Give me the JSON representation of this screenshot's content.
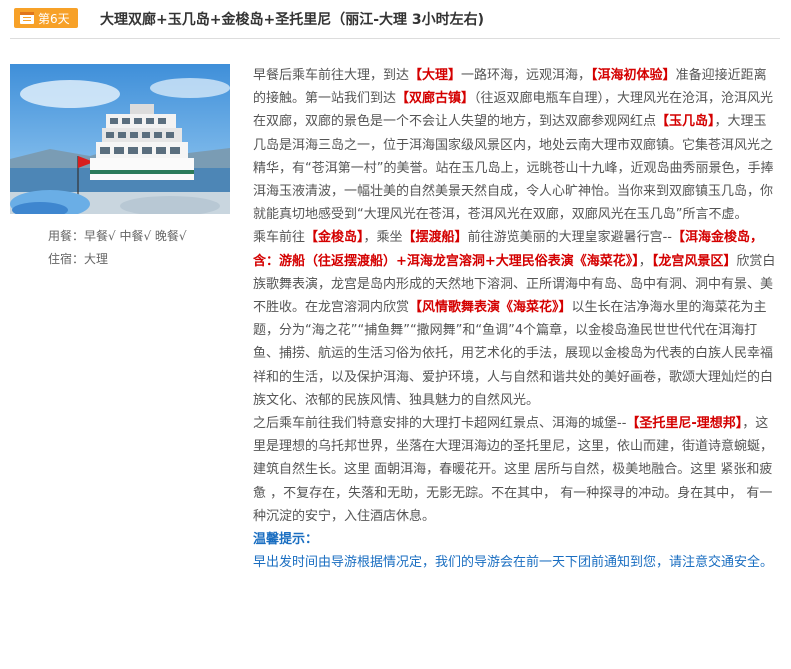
{
  "header": {
    "day_label": "第6天",
    "title": "大理双廊+玉几岛+金梭岛+圣托里尼（丽江-大理 3小时左右)"
  },
  "sidebar": {
    "meals": "用餐：早餐√  中餐√  晚餐√",
    "stay": "住宿：大理"
  },
  "paragraphs": [
    [
      {
        "t": "早餐后乘车前往大理，到达"
      },
      {
        "t": "【大理】",
        "h": true
      },
      {
        "t": "一路环海，远观洱海，"
      },
      {
        "t": "【洱海初体验】",
        "h": true
      },
      {
        "t": "准备迎接近距离的接触。第一站我们到达"
      },
      {
        "t": "【双廊古镇】",
        "h": true
      },
      {
        "t": "（往返双廊电瓶车自理），大理风光在沧洱，沧洱风光在双廊，双廊的景色是一个不会让人失望的地方，到达双廊参观网红点"
      },
      {
        "t": "【玉几岛】",
        "h": true
      },
      {
        "t": "，大理玉几岛是洱海三岛之一，位于洱海国家级风景区内，地处云南大理市双廊镇。它集苍洱风光之精华，有“苍洱第一村”的美誉。站在玉几岛上，远眺苍山十九峰，近观岛曲秀丽景色，手捧洱海玉液清波，一幅壮美的自然美景天然自成，令人心旷神怡。当你来到双廊镇玉几岛，你就能真切地感受到“大理风光在苍洱，苍洱风光在双廊，双廊风光在玉几岛”所言不虚。"
      }
    ],
    [
      {
        "t": "乘车前往"
      },
      {
        "t": "【金梭岛】",
        "h": true
      },
      {
        "t": "，乘坐"
      },
      {
        "t": "【摆渡船】",
        "h": true
      },
      {
        "t": "前往游览美丽的大理皇家避暑行宫--"
      },
      {
        "t": "【洱海金梭岛，含：游船（往返摆渡船）+洱海龙宫溶洞+大理民俗表演《海菜花》】",
        "h": true
      },
      {
        "t": "，"
      },
      {
        "t": "【龙宫风景区】",
        "h": true
      },
      {
        "t": "欣赏白族歌舞表演，龙宫是岛内形成的天然地下溶洞、正所谓海中有岛、岛中有洞、洞中有景、美不胜收。在龙宫溶洞内欣赏"
      },
      {
        "t": "【风情歌舞表演《海菜花》】",
        "h": true
      },
      {
        "t": "以生长在洁净海水里的海菜花为主题，分为“海之花”“捕鱼舞”“撒网舞”和“鱼调”4个篇章，以金梭岛渔民世世代代在洱海打鱼、捕捞、航运的生活习俗为依托，用艺术化的手法，展现以金梭岛为代表的白族人民幸福祥和的生活，以及保护洱海、爱护环境，人与自然和谐共处的美好画卷，歌颂大理灿烂的白族文化、浓郁的民族风情、独具魅力的自然风光。"
      }
    ],
    [
      {
        "t": "之后乘车前往我们特意安排的大理打卡超网红景点、洱海的城堡--"
      },
      {
        "t": "【圣托里尼-理想邦】",
        "h": true
      },
      {
        "t": "，这里是理想的乌托邦世界，坐落在大理洱海边的圣托里尼，这里，依山而建，街道诗意蜿蜒，建筑自然生长。这里 面朝洱海，春暖花开。这里 居所与自然，极美地融合。这里 紧张和疲惫 ，不复存在，失落和无助，无影无踪。不在其中， 有一种探寻的冲动。身在其中， 有一种沉淀的安宁，入住酒店休息。"
      }
    ]
  ],
  "tips": {
    "title": "温馨提示：",
    "body": "早出发时间由导游根据情况定，我们的导游会在前一天下团前通知到您，请注意交通安全。"
  }
}
